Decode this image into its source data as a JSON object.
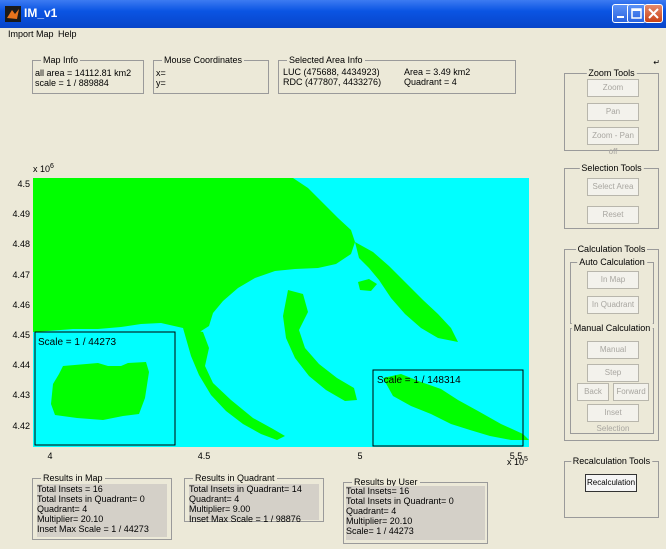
{
  "window": {
    "title": "IM_v1"
  },
  "menu": {
    "items": [
      "Import Map",
      "Help"
    ]
  },
  "map_info": {
    "title": "Map Info",
    "lines": [
      "all area = 14112.81 km2",
      "scale = 1 / 889884"
    ]
  },
  "mouse_coords": {
    "title": "Mouse Coordinates",
    "x_label": "x=",
    "y_label": "y="
  },
  "selected_area": {
    "title": "Selected Area Info",
    "luc": "LUC (475688, 4434923)",
    "rdc": "RDC (477807, 4433276)",
    "area": "Area = 3.49 km2",
    "quadrant": "Quadrant = 4"
  },
  "zoom_tools": {
    "title": "Zoom Tools",
    "zoom": "Zoom",
    "pan": "Pan",
    "zoom_pan_off": "Zoom - Pan off"
  },
  "selection_tools": {
    "title": "Selection Tools",
    "select_area": "Select Area",
    "reset": "Reset"
  },
  "calculation_tools": {
    "title": "Calculation Tools",
    "auto_title": "Auto Calculation",
    "in_map": "In Map",
    "in_quadrant": "In Quadrant",
    "manual_title": "Manual Calculation",
    "manual": "Manual",
    "step": "Step",
    "back": "Back",
    "forward": "Forward",
    "inset_selection": "Inset Selection"
  },
  "recalc_tools": {
    "title": "Recalculation Tools",
    "recalculation": "Recalculation"
  },
  "map": {
    "y_exponent": "x 10",
    "y_exp_power": "6",
    "x_exponent": "x 10",
    "x_exp_power": "5",
    "y_ticks": [
      "4.5",
      "4.49",
      "4.48",
      "4.47",
      "4.46",
      "4.45",
      "4.44",
      "4.43",
      "4.42"
    ],
    "x_ticks": [
      "4",
      "4.5",
      "5",
      "5.5"
    ],
    "inset_left_label": "Scale = 1 / 44273",
    "inset_right_label": "Scale = 1 / 148314",
    "colors": {
      "sea": "#00ffff",
      "land": "#00ff00"
    }
  },
  "results_map": {
    "title": "Results in Map",
    "lines": [
      "Total Insets = 16",
      "Total Insets in Quadrant= 0",
      "Quadrant= 4",
      "Multiplier= 20.10",
      "Inset Max Scale = 1 / 44273"
    ]
  },
  "results_quadrant": {
    "title": "Results in Quadrant",
    "lines": [
      "Total Insets in Quadrant= 14",
      "Quadrant= 4",
      "Multiplier= 9.00",
      "Inset Max Scale = 1 / 98876"
    ]
  },
  "results_user": {
    "title": "Results by User",
    "lines": [
      "Total Insets= 16",
      "Total Insets in Quadrant= 0",
      "Quadrant= 4",
      "Multiplier= 20.10",
      "Scale= 1 / 44273"
    ]
  }
}
